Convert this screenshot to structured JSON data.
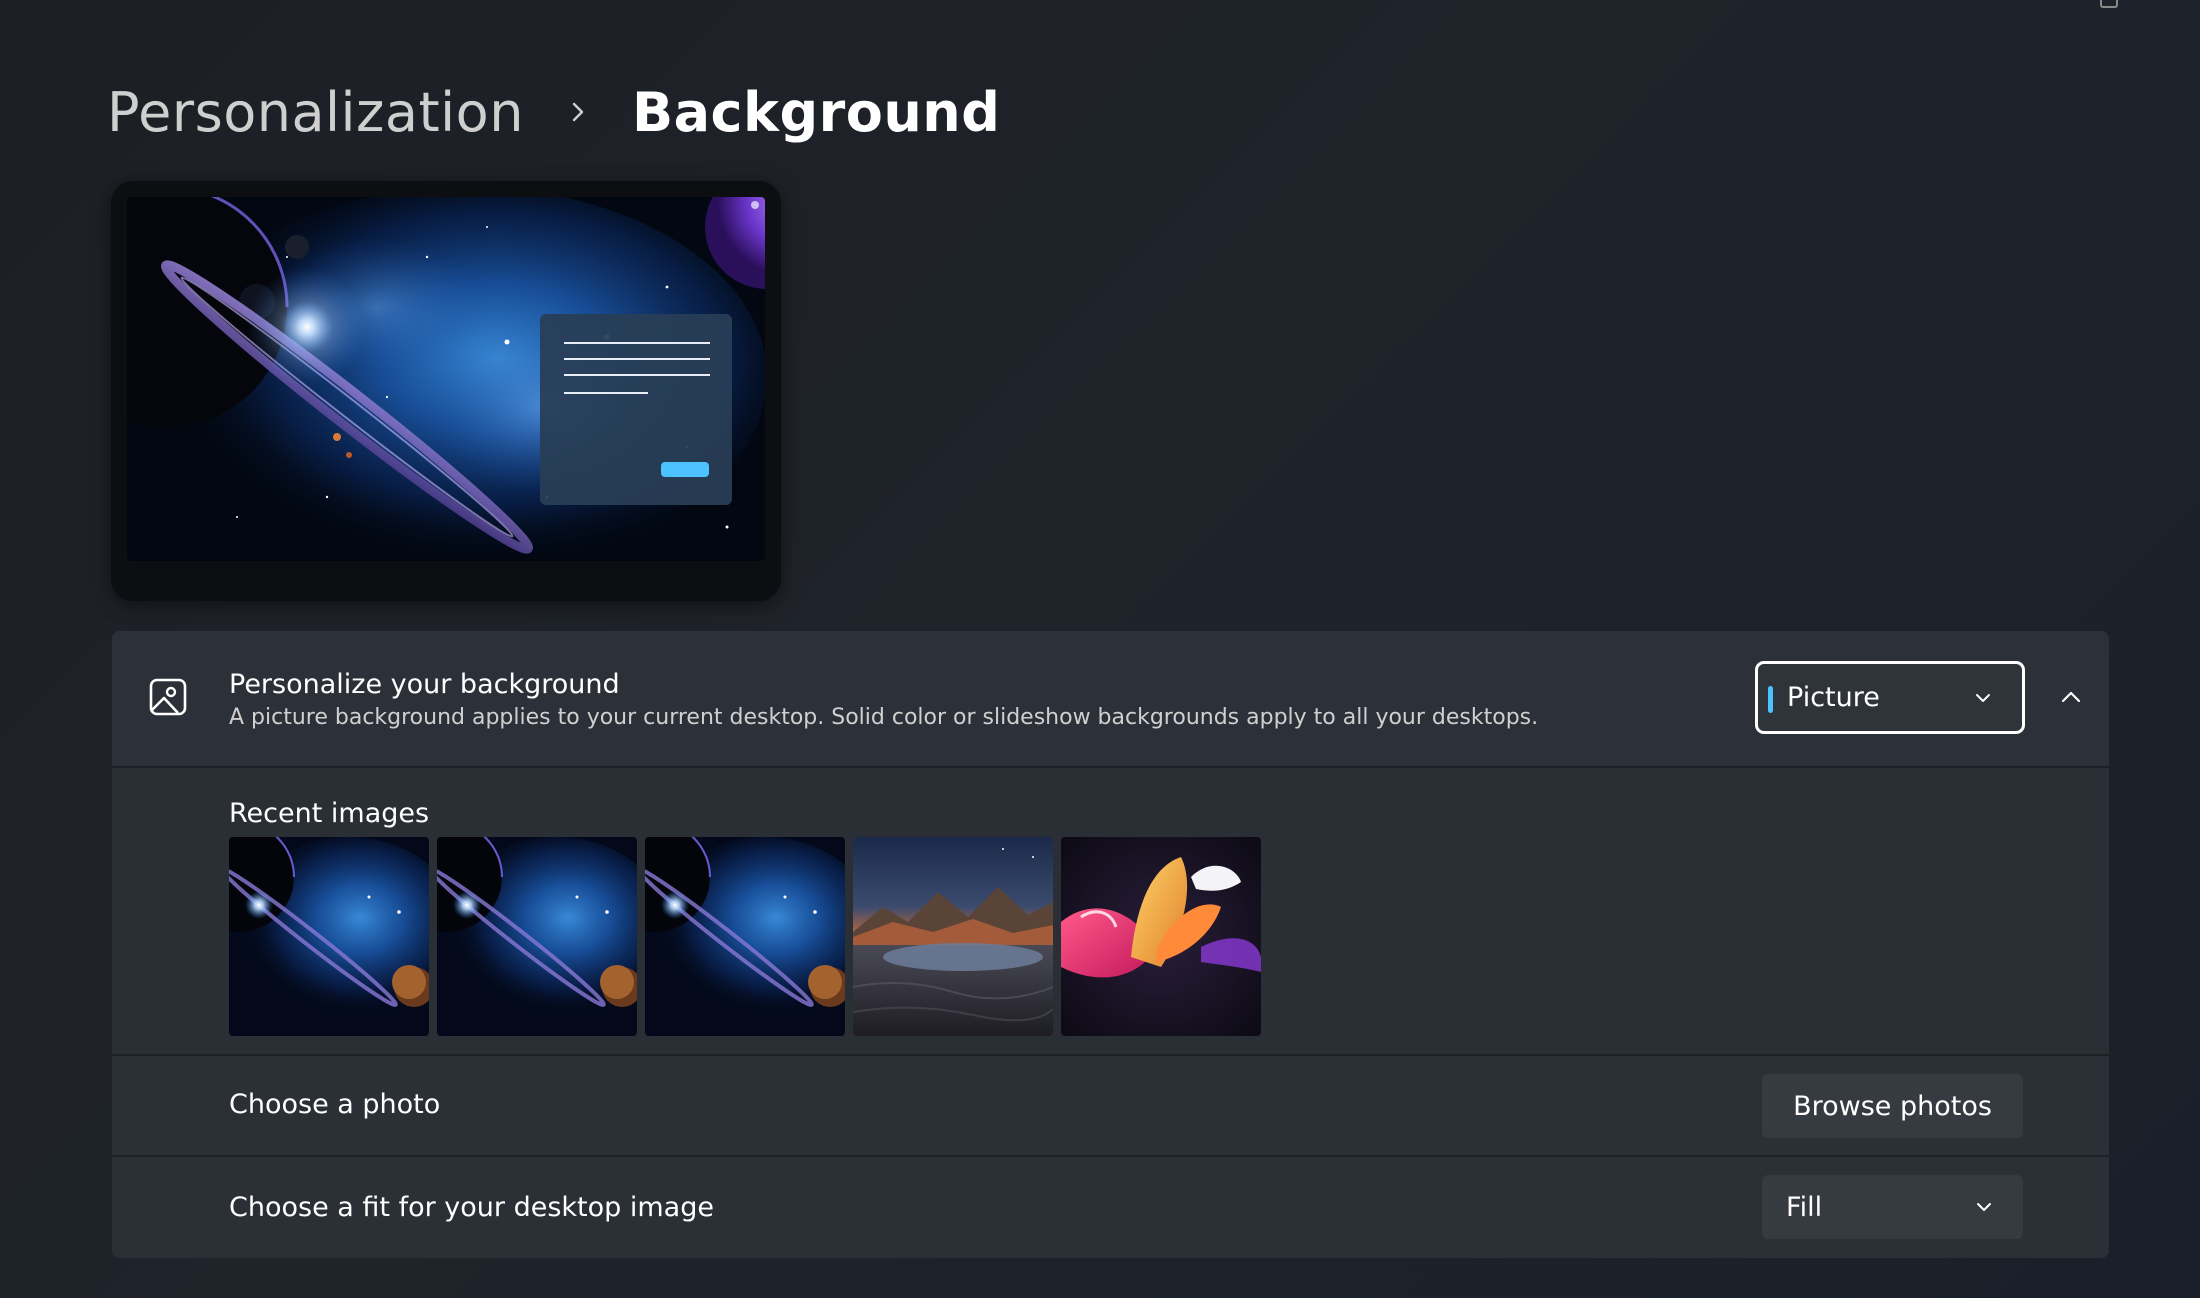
{
  "breadcrumb": {
    "parent": "Personalization",
    "current": "Background"
  },
  "personalize": {
    "title": "Personalize your background",
    "description": "A picture background applies to your current desktop. Solid color or slideshow backgrounds apply to all your desktops.",
    "type_selected": "Picture"
  },
  "recent_images": {
    "title": "Recent images",
    "items": [
      {
        "name": "space-planet-wallpaper"
      },
      {
        "name": "space-planet-wallpaper"
      },
      {
        "name": "space-planet-wallpaper"
      },
      {
        "name": "mountain-lake-sunset-wallpaper"
      },
      {
        "name": "abstract-3d-shapes-wallpaper"
      }
    ]
  },
  "choose_photo": {
    "label": "Choose a photo",
    "button": "Browse photos"
  },
  "choose_fit": {
    "label": "Choose a fit for your desktop image",
    "selected": "Fill"
  },
  "colors": {
    "accent": "#4cc2ff",
    "background": "#1e2127",
    "card": "#2b2f36"
  },
  "icons": {
    "breadcrumb_separator": "chevron-right-icon",
    "personalize": "picture-icon",
    "dropdown": "chevron-down-icon",
    "collapse": "chevron-up-icon"
  }
}
